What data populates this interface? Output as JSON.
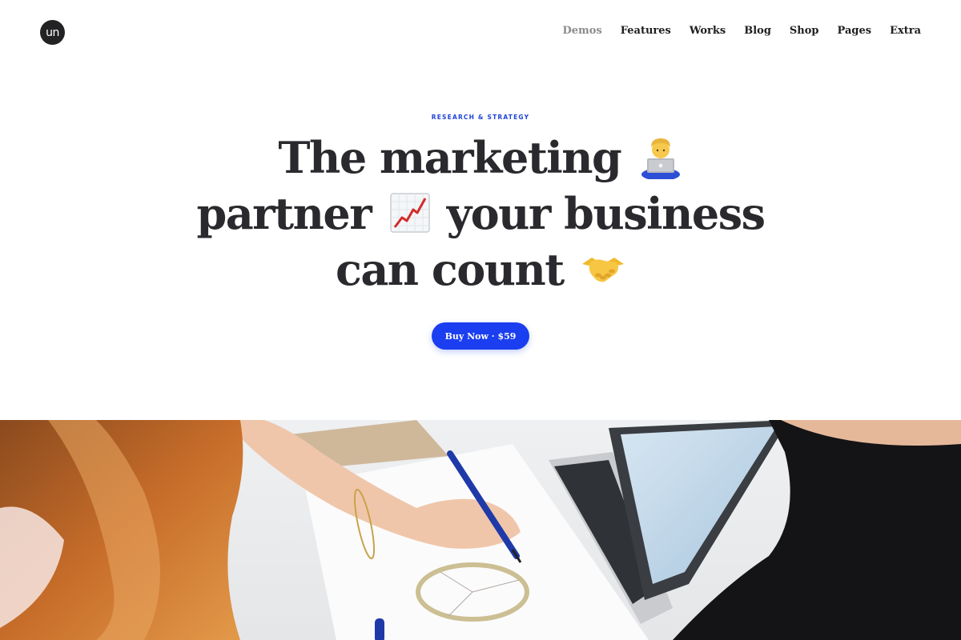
{
  "header": {
    "logo_text": "un",
    "nav": [
      {
        "label": "Demos",
        "muted": true
      },
      {
        "label": "Features"
      },
      {
        "label": "Works"
      },
      {
        "label": "Blog"
      },
      {
        "label": "Shop"
      },
      {
        "label": "Pages"
      },
      {
        "label": "Extra"
      }
    ]
  },
  "hero": {
    "eyebrow": "RESEARCH & STRATEGY",
    "line1": "The marketing",
    "line2a": "partner",
    "line2b": "your business",
    "line3": "can count",
    "emoji_1": "person-with-laptop-emoji",
    "emoji_2": "chart-increasing-emoji",
    "emoji_3": "handshake-emoji",
    "cta_label": "Buy Now · $59"
  },
  "colors": {
    "accent": "#1a3ef0",
    "heading": "#2a2a2e",
    "eyebrow": "#1f44d8"
  },
  "photo": {
    "subject": "hero-photo-people-working-with-laptop-and-chart"
  }
}
